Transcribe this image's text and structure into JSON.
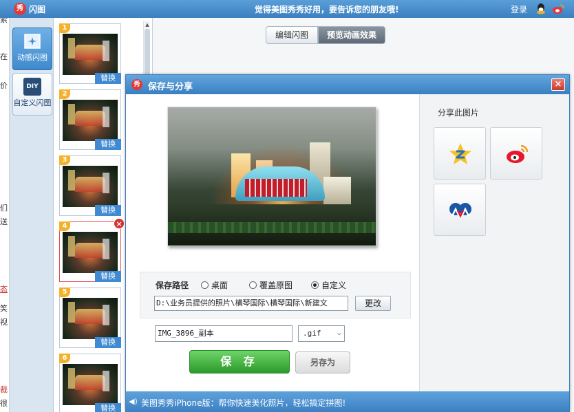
{
  "app": {
    "title": "闪图",
    "logo_text": "秀",
    "slogan": "觉得美图秀秀好用，要告诉您的朋友哦!",
    "login_label": "登录",
    "icons": [
      "qq-icon",
      "weibo-icon"
    ]
  },
  "left_strip_chars": [
    "索",
    "在",
    "价",
    "们",
    "送",
    "态",
    "笑",
    "视",
    "裁",
    "很"
  ],
  "tool_nav": [
    {
      "label": "动感闪图",
      "icon": "sparkle-picture-icon",
      "active": true
    },
    {
      "label": "自定义闪图",
      "icon": "diy-icon",
      "icon_text": "DIY",
      "active": false
    }
  ],
  "thumbnails": [
    {
      "number": "1",
      "action": "替换"
    },
    {
      "number": "2",
      "action": "替换"
    },
    {
      "number": "3",
      "action": "替换"
    },
    {
      "number": "4",
      "action": "替换",
      "selected": true,
      "delete_icon": "×"
    },
    {
      "number": "5",
      "action": "替换"
    },
    {
      "number": "6",
      "action": "替换"
    }
  ],
  "tabs": {
    "edit": "编辑闪图",
    "preview": "预览动画效果"
  },
  "dialog": {
    "logo_text": "秀",
    "title": "保存与分享",
    "close_label": "×",
    "save_path": {
      "label": "保存路径",
      "options": [
        "桌面",
        "覆盖原图",
        "自定义"
      ],
      "selected": "自定义",
      "path_value": "D:\\业务员提供的照片\\横琴国际\\横琴国际\\新建文",
      "change_button": "更改"
    },
    "filename": "IMG_3896_副本",
    "format": ".gif",
    "format_arrow": "⌵",
    "save_button": "保 存",
    "save_as_button": "另存为",
    "share": {
      "title": "分享此图片",
      "targets": [
        "qzone-icon",
        "sina-weibo-icon",
        "renren-icon"
      ]
    },
    "status_icon": "◀)",
    "status": "美图秀秀iPhone版：帮你快速美化照片，轻松搞定拼图!"
  },
  "colors": {
    "accent": "#3b7fc0",
    "save_green": "#2c9a2a",
    "close_red": "#c8382a"
  }
}
